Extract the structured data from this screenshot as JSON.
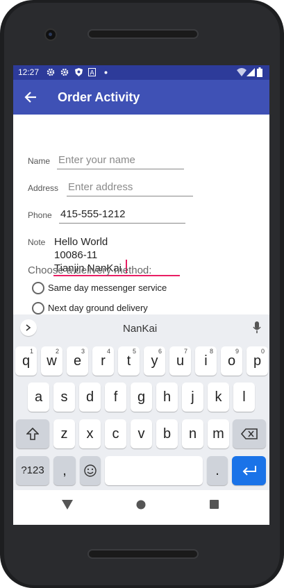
{
  "status_bar": {
    "time": "12:27",
    "left_icons": [
      "gear-icon",
      "gear-icon",
      "shield-icon",
      "a-icon",
      "dot-icon"
    ],
    "right_icons": [
      "wifi-icon",
      "signal-icon",
      "battery-icon"
    ]
  },
  "app_bar": {
    "title": "Order Activity",
    "back_icon": "arrow-left-icon",
    "color": "#3f51b5"
  },
  "form": {
    "name": {
      "label": "Name",
      "placeholder": "Enter your name",
      "value": ""
    },
    "address": {
      "label": "Address",
      "placeholder": "Enter address",
      "value": ""
    },
    "phone": {
      "label": "Phone",
      "value": "415-555-1212"
    },
    "note": {
      "label": "Note",
      "lines": [
        "Hello World",
        "10086-11",
        "Tianjin NanKai"
      ]
    },
    "delivery_heading": "Choose a delivery method:",
    "options": [
      "Same day messenger service",
      "Next day ground delivery"
    ]
  },
  "keyboard": {
    "suggestion": "NanKai",
    "row1": [
      "q",
      "w",
      "e",
      "r",
      "t",
      "y",
      "u",
      "i",
      "o",
      "p"
    ],
    "row1_hints": [
      "1",
      "2",
      "3",
      "4",
      "5",
      "6",
      "7",
      "8",
      "9",
      "0"
    ],
    "row2": [
      "a",
      "s",
      "d",
      "f",
      "g",
      "h",
      "j",
      "k",
      "l"
    ],
    "row3": [
      "z",
      "x",
      "c",
      "v",
      "b",
      "n",
      "m"
    ],
    "sym_key": "?123",
    "comma_key": ",",
    "period_key": ".",
    "accent": "#1a73e8"
  },
  "nav_bar": {
    "icons": [
      "back-triangle-icon",
      "home-circle-icon",
      "recents-square-icon"
    ]
  }
}
